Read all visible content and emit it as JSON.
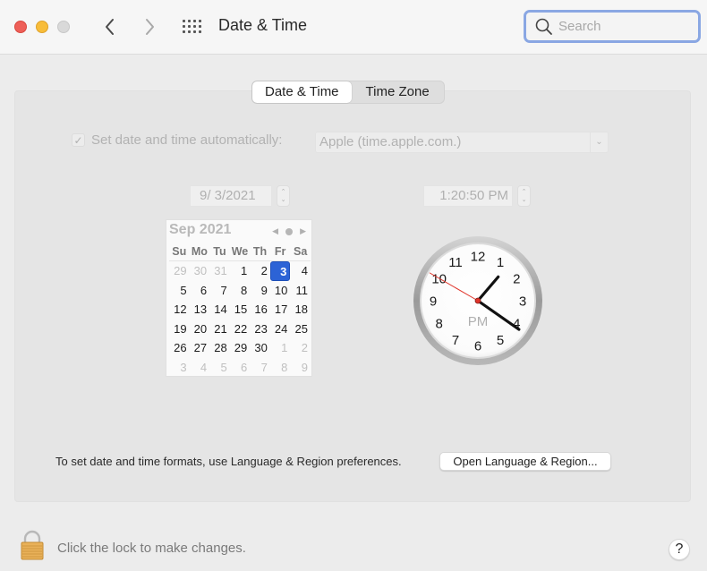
{
  "window": {
    "title": "Date & Time",
    "search": {
      "placeholder": "Search",
      "value": ""
    }
  },
  "tabs": [
    {
      "label": "Date & Time",
      "active": true
    },
    {
      "label": "Time Zone",
      "active": false
    }
  ],
  "auto": {
    "checked": true,
    "label": "Set date and time automatically:",
    "server": "Apple (time.apple.com.)"
  },
  "date_field": "9/  3/2021",
  "time_field": "1:20:50 PM",
  "calendar": {
    "month_label": "Sep 2021",
    "weekdays": [
      "Su",
      "Mo",
      "Tu",
      "We",
      "Th",
      "Fr",
      "Sa"
    ],
    "weeks": [
      [
        {
          "d": "29",
          "o": true
        },
        {
          "d": "30",
          "o": true
        },
        {
          "d": "31",
          "o": true
        },
        {
          "d": "1"
        },
        {
          "d": "2"
        },
        {
          "d": "3",
          "sel": true
        },
        {
          "d": "4"
        }
      ],
      [
        {
          "d": "5"
        },
        {
          "d": "6"
        },
        {
          "d": "7"
        },
        {
          "d": "8"
        },
        {
          "d": "9"
        },
        {
          "d": "10"
        },
        {
          "d": "11"
        }
      ],
      [
        {
          "d": "12"
        },
        {
          "d": "13"
        },
        {
          "d": "14"
        },
        {
          "d": "15"
        },
        {
          "d": "16"
        },
        {
          "d": "17"
        },
        {
          "d": "18"
        }
      ],
      [
        {
          "d": "19"
        },
        {
          "d": "20"
        },
        {
          "d": "21"
        },
        {
          "d": "22"
        },
        {
          "d": "23"
        },
        {
          "d": "24"
        },
        {
          "d": "25"
        }
      ],
      [
        {
          "d": "26"
        },
        {
          "d": "27"
        },
        {
          "d": "28"
        },
        {
          "d": "29"
        },
        {
          "d": "30"
        },
        {
          "d": "1",
          "o": true
        },
        {
          "d": "2",
          "o": true
        }
      ],
      [
        {
          "d": "3",
          "o": true
        },
        {
          "d": "4",
          "o": true
        },
        {
          "d": "5",
          "o": true
        },
        {
          "d": "6",
          "o": true
        },
        {
          "d": "7",
          "o": true
        },
        {
          "d": "8",
          "o": true
        },
        {
          "d": "9",
          "o": true
        }
      ]
    ]
  },
  "clock": {
    "hour": 1,
    "minute": 20,
    "second": 50,
    "meridiem": "PM",
    "numerals": [
      "12",
      "1",
      "2",
      "3",
      "4",
      "5",
      "6",
      "7",
      "8",
      "9",
      "10",
      "11"
    ]
  },
  "formats": {
    "text": "To set date and time formats, use Language & Region preferences.",
    "button": "Open Language & Region..."
  },
  "footer": {
    "lock_text": "Click the lock to make changes.",
    "help_label": "?"
  },
  "colors": {
    "accent": "#2c63d6",
    "search_focus": "#8aa7e3",
    "second_hand": "#e0342a"
  }
}
